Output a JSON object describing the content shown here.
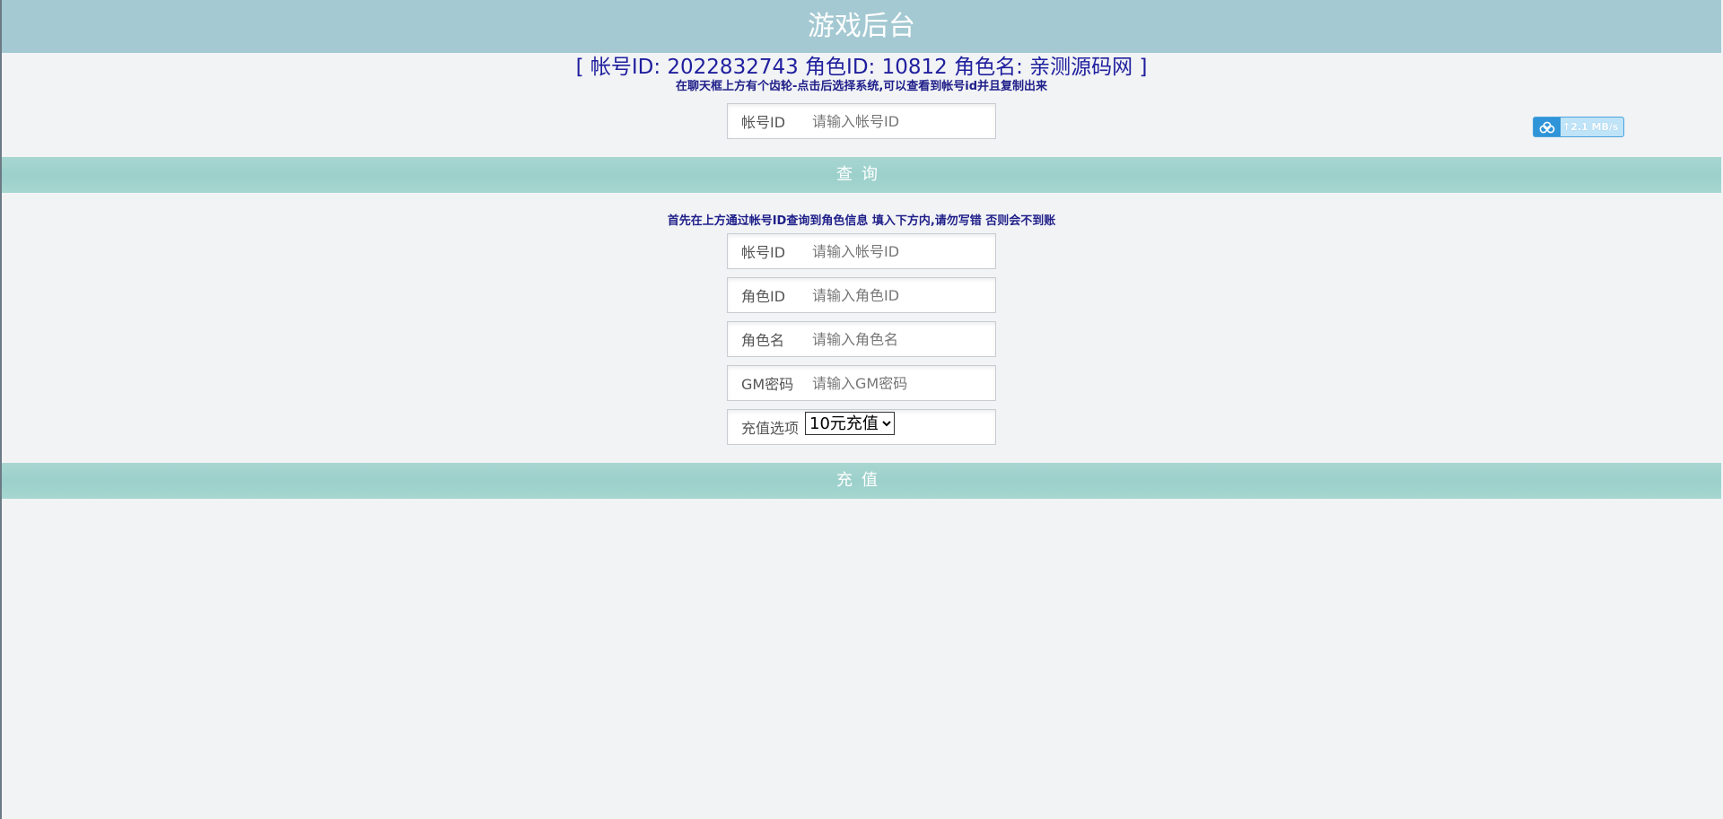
{
  "header": {
    "title": "游戏后台"
  },
  "account_info": {
    "text": "[ 帐号ID: 2022832743 角色ID: 10812 角色名: 亲测源码网 ]",
    "hint": "在聊天框上方有个齿轮-点击后选择系统,可以查看到帐号id并且复制出来"
  },
  "query_form": {
    "account_label": "帐号ID",
    "account_placeholder": "请输入帐号ID",
    "submit_label": "查询"
  },
  "recharge_form": {
    "instruction": "首先在上方通过帐号ID查询到角色信息 填入下方内,请勿写错 否则会不到账",
    "account_label": "帐号ID",
    "account_placeholder": "请输入帐号ID",
    "role_id_label": "角色ID",
    "role_id_placeholder": "请输入角色ID",
    "role_name_label": "角色名",
    "role_name_placeholder": "请输入角色名",
    "gm_password_label": "GM密码",
    "gm_password_placeholder": "请输入GM密码",
    "option_label": "充值选项",
    "option_selected": "10元充值",
    "submit_label": "充值"
  },
  "upload_widget": {
    "icon": "cloud-upload-icon",
    "speed": "↑2.1 MB/s"
  }
}
